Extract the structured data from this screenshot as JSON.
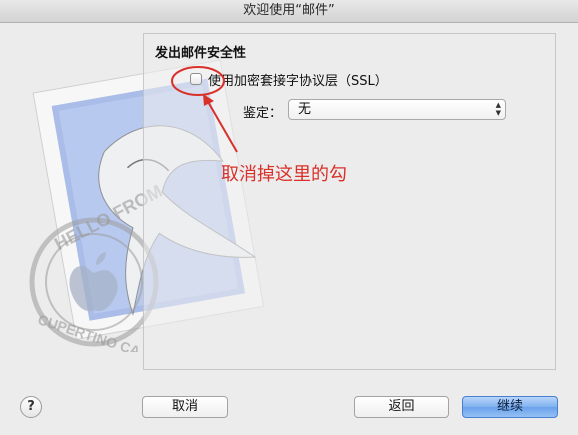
{
  "window": {
    "title": "欢迎使用“邮件”"
  },
  "section": {
    "title": "发出邮件安全性"
  },
  "ssl": {
    "label": "使用加密套接字协议层（SSL）",
    "checked": false
  },
  "auth": {
    "label": "鉴定：",
    "value": "无"
  },
  "annotation": {
    "text": "取消掉这里的勾",
    "color": "#d9302a"
  },
  "stamp": {
    "text_top": "HELLO FROM",
    "text_bottom": "CUPERTINO CA"
  },
  "buttons": {
    "help": "?",
    "cancel": "取消",
    "back": "返回",
    "continue": "继续"
  },
  "colors": {
    "accent": "#6aa2ec",
    "annotation": "#d9302a",
    "background": "#ececec"
  },
  "icons": {
    "select": "updown-arrows-icon",
    "help": "question-icon"
  }
}
